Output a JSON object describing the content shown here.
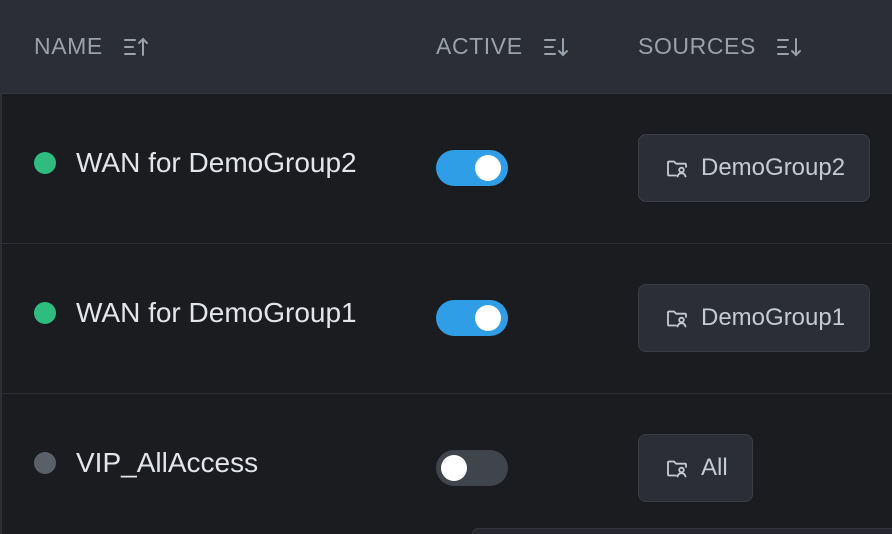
{
  "header": {
    "columns": [
      {
        "label": "NAME",
        "sort": "ascending"
      },
      {
        "label": "ACTIVE",
        "sort": "descending"
      },
      {
        "label": "SOURCES",
        "sort": "descending"
      }
    ]
  },
  "rows": [
    {
      "name": "WAN for DemoGroup2",
      "status_color": "#2ebd7f",
      "active": true,
      "source": "DemoGroup2",
      "source_icon": "folder-user-icon"
    },
    {
      "name": "WAN for DemoGroup1",
      "status_color": "#2ebd7f",
      "active": true,
      "source": "DemoGroup1",
      "source_icon": "folder-user-icon"
    },
    {
      "name": "VIP_AllAccess",
      "status_color": "#5b6068",
      "active": false,
      "source": "All",
      "source_icon": "folder-user-icon"
    }
  ],
  "colors": {
    "accent": "#2f9ee6",
    "background": "#1b1c1f",
    "header_background": "#2b2e34",
    "status_active": "#2ebd7f",
    "status_inactive": "#5b6068"
  }
}
